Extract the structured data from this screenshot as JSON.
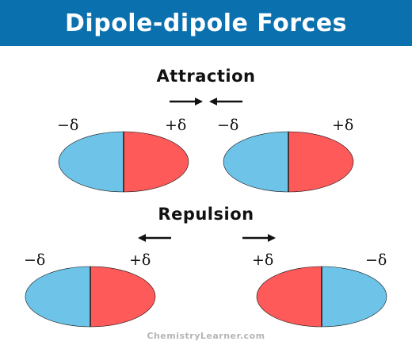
{
  "title": "Dipole-dipole Forces",
  "sections": {
    "attraction": "Attraction",
    "repulsion": "Repulsion"
  },
  "charges": {
    "negative": "−δ",
    "positive": "+δ"
  },
  "footer": "ChemistryLearner.com",
  "colors": {
    "header_bg": "#0a70ae",
    "negative_pole": "#6ec3e8",
    "positive_pole": "#fe5a5a",
    "outline": "#111111",
    "footer_text": "#b5b5b5"
  }
}
